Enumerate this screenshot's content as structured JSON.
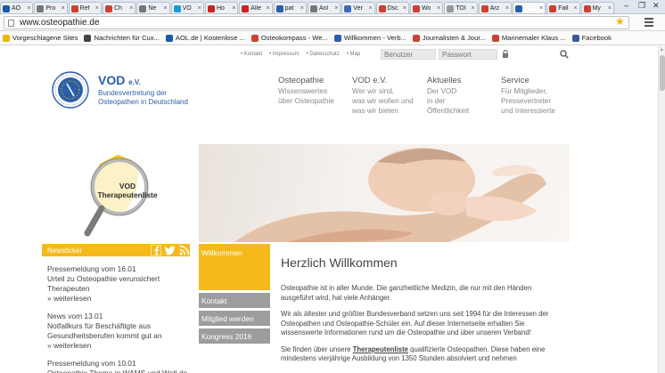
{
  "browser": {
    "tabs": [
      {
        "label": "AO",
        "color": "#1a5aa6"
      },
      {
        "label": "Pro",
        "color": "#777777"
      },
      {
        "label": "Ref",
        "color": "#d04030"
      },
      {
        "label": "Ch",
        "color": "#d04030"
      },
      {
        "label": "Ne",
        "color": "#777777"
      },
      {
        "label": "VO",
        "color": "#1a9ad6"
      },
      {
        "label": "Ho",
        "color": "#d02020"
      },
      {
        "label": "Alle",
        "color": "#d02020"
      },
      {
        "label": "pat",
        "color": "#2a5ea8"
      },
      {
        "label": "Anl",
        "color": "#777777"
      },
      {
        "label": "Ver",
        "color": "#3a6bb8"
      },
      {
        "label": "Dsc",
        "color": "#d04030"
      },
      {
        "label": "Wo",
        "color": "#d04030"
      },
      {
        "label": "TOI",
        "color": "#999999"
      },
      {
        "label": "Arz",
        "color": "#d04030"
      },
      {
        "label": "",
        "color": "#2a5ea8",
        "active": true
      },
      {
        "label": "Fall",
        "color": "#d04030"
      },
      {
        "label": "My",
        "color": "#d04030"
      }
    ],
    "url": "www.osteopathie.de",
    "bookmarks": [
      {
        "label": "Vorgeschlagene Sites",
        "color": "#f3b400"
      },
      {
        "label": "Nachrichten für Cux...",
        "color": "#444444"
      },
      {
        "label": "AOL.de | Kostenlose ...",
        "color": "#1a5aa6"
      },
      {
        "label": "Osteokompass - We...",
        "color": "#d04030"
      },
      {
        "label": "Willkommen - Verb...",
        "color": "#2a5ea8"
      },
      {
        "label": "Journalisten & Jour...",
        "color": "#d04030"
      },
      {
        "label": "Marinemaler Klaus ...",
        "color": "#d04030"
      },
      {
        "label": "Facebook",
        "color": "#3b5998"
      }
    ]
  },
  "site": {
    "toplinks": [
      "• Kontakt",
      "• Impressum",
      "• Datenschutz",
      "• Map"
    ],
    "login": {
      "user_placeholder": "Benutzer",
      "pass_placeholder": "Passwort"
    },
    "logo": {
      "title": "VOD",
      "title_suffix": "e.V.",
      "subtitle": "Bundesvertretung der Osteopathen in Deutschland"
    },
    "nav": [
      {
        "title": "Osteopathie",
        "lines": [
          "Wissenswertes",
          "über Osteopathie"
        ]
      },
      {
        "title": "VOD e.V.",
        "lines": [
          "Wer wir sind,",
          "was wir wollen und",
          "was wir bieten"
        ]
      },
      {
        "title": "Aktuelles",
        "lines": [
          "Der VOD",
          "in der",
          "Öffentlichkeit"
        ]
      },
      {
        "title": "Service",
        "lines": [
          "Für Mitglieder,",
          "Pressevertreter",
          "und Interessierte"
        ]
      }
    ],
    "finder": {
      "line1": "VOD",
      "line2": "Therapeutenliste"
    },
    "news": {
      "title": "Newsticker",
      "items": [
        {
          "date": "Pressemeldung vom 16.01",
          "text": "Urteil zu Osteopathie verunsichert Therapeuten",
          "more": "» weiterlesen"
        },
        {
          "date": "News vom 13.01",
          "text": "Notfallkurs für Beschäftigte aus Gesundheitsberufen kommt gut an",
          "more": "» weiterlesen"
        },
        {
          "date": "Pressemeldung vom 10.01",
          "text": "Osteopathie Thema in WAMS und Welt.de",
          "more": ""
        }
      ]
    },
    "subnav": {
      "active": "Willkommen",
      "items": [
        "Kontakt",
        "Mitglied werden",
        "Kongress 2016"
      ]
    },
    "main": {
      "heading": "Herzlich Willkommen",
      "p1": "Osteopathie ist in aller Munde. Die ganzheitliche Medizin, die nur mit den Händen ausgeführt wird, hat viele Anhänger.",
      "p2": "Wir als ältester und größter Bundesverband setzen uns seit 1994 für die Interessen der Osteopathen und Osteopathie-Schüler ein. Auf dieser Internetseite erhalten Sie wissenswerte Informationen rund um die Osteopathie und über unseren Verband!",
      "p3_pre": "Sie finden über unsere ",
      "p3_link": "Therapeutenliste",
      "p3_post": " qualifizierte Osteopathen. Diese haben eine mindestens vierjährige Ausbildung von 1350 Stunden absolviert und nehmen"
    },
    "colors": {
      "accent": "#f5b91c",
      "brand": "#2a5ea8",
      "subnav_gray": "#9d9d9d"
    }
  }
}
